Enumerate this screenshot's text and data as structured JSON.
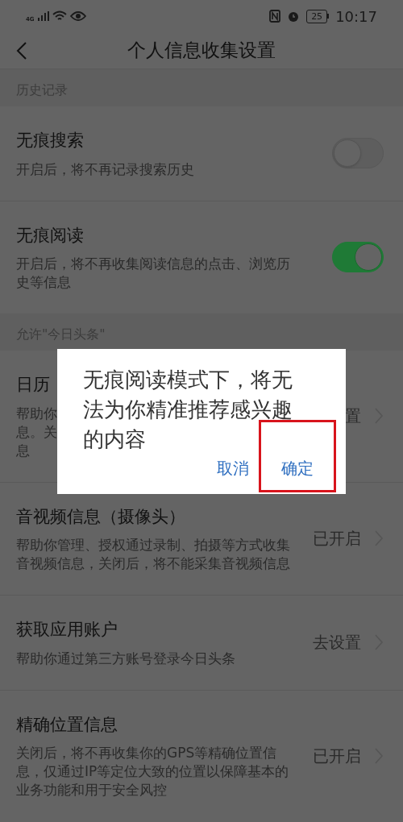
{
  "status_bar": {
    "network": "4G",
    "battery": "25",
    "time": "10:17"
  },
  "nav": {
    "title": "个人信息收集设置"
  },
  "sections": [
    {
      "header": "历史记录",
      "items": [
        {
          "kind": "switch",
          "title": "无痕搜索",
          "description": "开启后，将不再记录搜索历史",
          "on": false
        },
        {
          "kind": "switch",
          "title": "无痕阅读",
          "description": "开启后，将不再收集阅读信息的点击、浏览历史等信息",
          "on": true
        }
      ]
    },
    {
      "header": "允许\"今日头条\"",
      "items": [
        {
          "kind": "link",
          "title": "日历",
          "description_lines": [
            "帮助你",
            "息。关",
            "息"
          ],
          "value": "置"
        },
        {
          "kind": "link",
          "title": "音视频信息（摄像头）",
          "description": "帮助你管理、授权通过录制、拍摄等方式收集音视频信息，关闭后，将不能采集音视频信息",
          "value": "已开启"
        },
        {
          "kind": "link",
          "title": "获取应用账户",
          "description": "帮助你通过第三方账号登录今日头条",
          "value": "去设置"
        },
        {
          "kind": "link",
          "title": "精确位置信息",
          "description": "关闭后，将不再收集你的GPS等精确位置信息，仅通过IP等定位大致的位置以保障基本的业务功能和用于安全风控",
          "value": "已开启"
        }
      ]
    }
  ],
  "dialog": {
    "message": "无痕阅读模式下，将无法为你精准推荐感兴趣的内容",
    "buttons": [
      {
        "label": "取消",
        "highlighted": false
      },
      {
        "label": "确定",
        "highlighted": true
      }
    ]
  }
}
